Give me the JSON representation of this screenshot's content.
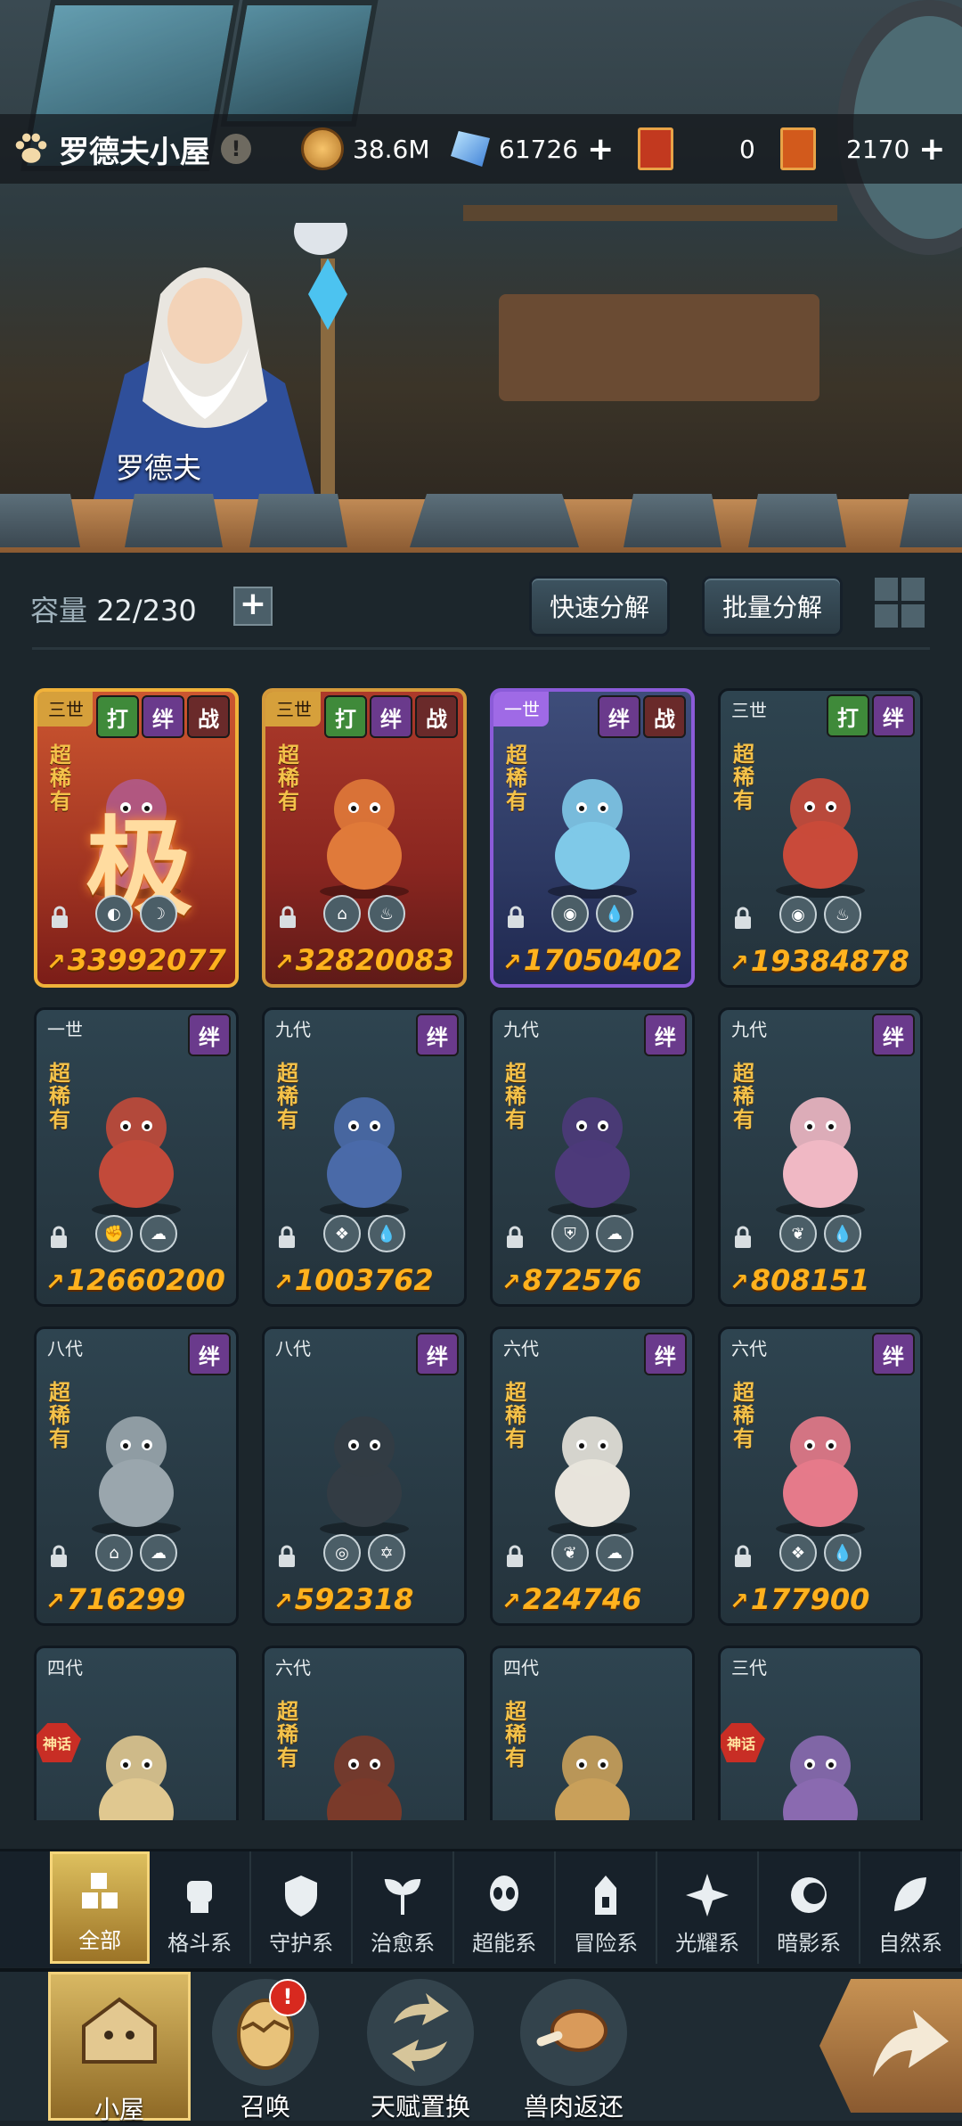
{
  "header": {
    "location": "罗德夫小屋",
    "info_icon": "!",
    "npc_name": "罗德夫",
    "currencies": [
      {
        "name": "gold-coin-icon",
        "value": "38.6M",
        "plus": false
      },
      {
        "name": "crystal-icon",
        "value": "61726",
        "plus": true,
        "plus_label": "+"
      },
      {
        "name": "ticket-red-icon",
        "value": "0",
        "plus": false
      },
      {
        "name": "ticket-orange-icon",
        "value": "2170",
        "plus": true,
        "plus_label": "+"
      }
    ]
  },
  "storage": {
    "label": "容量",
    "value": "22/230",
    "add_label": "+",
    "quick_decompose": "快速分解",
    "batch_decompose": "批量分解"
  },
  "cards": [
    {
      "gen": "三世",
      "band": true,
      "style": "gold",
      "badges": [
        "打",
        "绊",
        "战"
      ],
      "rarity": "超稀有",
      "power": "33992077",
      "elements": [
        "◐",
        "☽"
      ],
      "myth": false,
      "grade": "极"
    },
    {
      "gen": "三世",
      "band": true,
      "style": "red",
      "badges": [
        "打",
        "绊",
        "战"
      ],
      "rarity": "超稀有",
      "power": "32820083",
      "elements": [
        "⌂",
        "♨"
      ],
      "myth": false
    },
    {
      "gen": "一世",
      "band": true,
      "style": "purple",
      "badges": [
        "绊",
        "战"
      ],
      "rarity": "超稀有",
      "power": "17050402",
      "elements": [
        "◉",
        "💧"
      ],
      "myth": false
    },
    {
      "gen": "三世",
      "band": false,
      "style": "",
      "badges": [
        "打",
        "绊"
      ],
      "rarity": "超稀有",
      "power": "19384878",
      "elements": [
        "◉",
        "♨"
      ],
      "myth": false
    },
    {
      "gen": "一世",
      "band": false,
      "style": "",
      "badges": [
        "绊"
      ],
      "rarity": "超稀有",
      "power": "12660200",
      "elements": [
        "✊",
        "☁"
      ],
      "myth": false
    },
    {
      "gen": "九代",
      "band": false,
      "style": "",
      "badges": [
        "绊"
      ],
      "rarity": "超稀有",
      "power": "1003762",
      "elements": [
        "❖",
        "💧"
      ],
      "myth": false
    },
    {
      "gen": "九代",
      "band": false,
      "style": "",
      "badges": [
        "绊"
      ],
      "rarity": "超稀有",
      "power": "872576",
      "elements": [
        "⛨",
        "☁"
      ],
      "myth": false
    },
    {
      "gen": "九代",
      "band": false,
      "style": "",
      "badges": [
        "绊"
      ],
      "rarity": "超稀有",
      "power": "808151",
      "elements": [
        "❦",
        "💧"
      ],
      "myth": false
    },
    {
      "gen": "八代",
      "band": false,
      "style": "",
      "badges": [
        "绊"
      ],
      "rarity": "超稀有",
      "power": "716299",
      "elements": [
        "⌂",
        "☁"
      ],
      "myth": false
    },
    {
      "gen": "八代",
      "band": false,
      "style": "",
      "badges": [
        "绊"
      ],
      "rarity": "",
      "power": "592318",
      "elements": [
        "◎",
        "✡"
      ],
      "myth": false
    },
    {
      "gen": "六代",
      "band": false,
      "style": "",
      "badges": [
        "绊"
      ],
      "rarity": "超稀有",
      "power": "224746",
      "elements": [
        "❦",
        "☁"
      ],
      "myth": false
    },
    {
      "gen": "六代",
      "band": false,
      "style": "",
      "badges": [
        "绊"
      ],
      "rarity": "超稀有",
      "power": "177900",
      "elements": [
        "❖",
        "💧"
      ],
      "myth": false
    },
    {
      "gen": "四代",
      "band": false,
      "style": "",
      "badges": [],
      "rarity": "",
      "power": "",
      "elements": [],
      "myth": true,
      "myth_label": "神话"
    },
    {
      "gen": "六代",
      "band": false,
      "style": "",
      "badges": [],
      "rarity": "超稀有",
      "power": "",
      "elements": [],
      "myth": false
    },
    {
      "gen": "四代",
      "band": false,
      "style": "",
      "badges": [],
      "rarity": "超稀有",
      "power": "",
      "elements": [],
      "myth": false
    },
    {
      "gen": "三代",
      "band": false,
      "style": "",
      "badges": [],
      "rarity": "",
      "power": "",
      "elements": [],
      "myth": true,
      "myth_label": "神话"
    }
  ],
  "categories": [
    {
      "label": "全部",
      "icon": "all-blocks-icon",
      "active": true
    },
    {
      "label": "格斗系",
      "icon": "fist-icon"
    },
    {
      "label": "守护系",
      "icon": "shield-icon"
    },
    {
      "label": "治愈系",
      "icon": "sprout-icon"
    },
    {
      "label": "超能系",
      "icon": "alien-icon"
    },
    {
      "label": "冒险系",
      "icon": "tower-icon"
    },
    {
      "label": "光耀系",
      "icon": "star-compass-icon"
    },
    {
      "label": "暗影系",
      "icon": "eclipse-icon"
    },
    {
      "label": "自然系",
      "icon": "leaf-icon"
    }
  ],
  "nav": [
    {
      "label": "小屋",
      "icon": "house-icon",
      "active": true
    },
    {
      "label": "召唤",
      "icon": "egg-icon",
      "alert": "!"
    },
    {
      "label": "天赋置换",
      "icon": "swap-icon"
    },
    {
      "label": "兽肉返还",
      "icon": "meat-icon"
    }
  ],
  "colors": {
    "accent_gold": "#f0b23a",
    "power_text": "#ffb21e",
    "rarity_text": "#f4c24a",
    "alert_red": "#d8291f"
  }
}
